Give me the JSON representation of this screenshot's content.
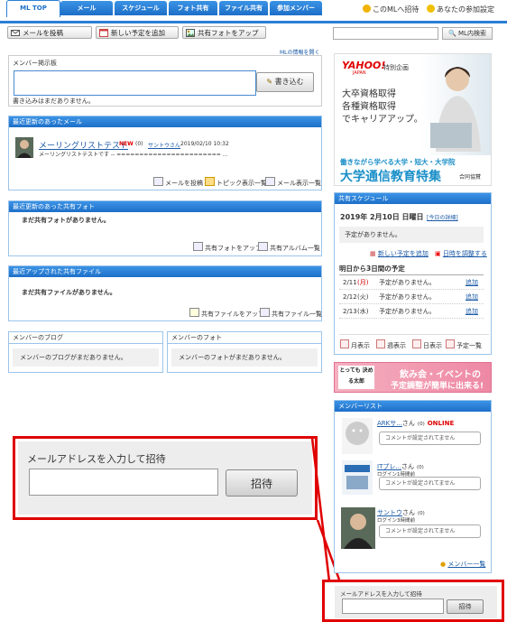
{
  "nav": {
    "tabs": [
      "ML TOP",
      "メール",
      "スケジュール",
      "フォト共有",
      "ファイル共有",
      "参加メンバー"
    ],
    "invite_link": "このMLへ招待",
    "settings_link": "あなたの参加設定"
  },
  "toolbar": {
    "post_mail": "メールを投稿",
    "add_schedule": "新しい予定を追加",
    "upload_photo": "共有フォトをアップ",
    "search_button": "ML内検索",
    "ml_info": "MLの情報を開く"
  },
  "board": {
    "title": "メンバー掲示板",
    "write_button": "書き込む",
    "empty": "書き込みはまだありません。"
  },
  "recent_mail": {
    "title": "最近更新のあったメール",
    "subject": "メーリングリストテスト",
    "new_badge": "NEW",
    "count": "(0)",
    "author": "サントウさん",
    "datetime": "2019/02/10 10:32",
    "preview": "メーリングリストテストです -- ======================= ...",
    "links": [
      "メールを投稿",
      "トピック表示一覧",
      "メール表示一覧"
    ]
  },
  "recent_photo": {
    "title": "最近更新のあった共有フォト",
    "empty": "まだ共有フォトがありません。",
    "links": [
      "共有フォトをアップ",
      "共有アルバム一覧"
    ]
  },
  "recent_file": {
    "title": "最近アップされた共有ファイル",
    "empty": "まだ共有ファイルがありません。",
    "links": [
      "共有ファイルをアップ",
      "共有ファイル一覧"
    ]
  },
  "member_blog": {
    "title": "メンバーのブログ",
    "empty": "メンバーのブログがまだありません。"
  },
  "member_photo": {
    "title": "メンバーのフォト",
    "empty": "メンバーのフォトがまだありません。"
  },
  "invite_zoom": {
    "label": "メールアドレスを入力して招待",
    "button": "招待"
  },
  "ad": {
    "logo": "YAHOO!",
    "logo_sub": "JAPAN",
    "tag": "特別企画",
    "lines": [
      "大卒資格取得",
      "各種資格取得",
      "でキャリアアップ。"
    ],
    "headline": "働きながら学べる大学・短大・大学院",
    "big": "大学通信教育特集",
    "sponsor": "合同協賛"
  },
  "schedule": {
    "title": "共有スケジュール",
    "date": "2019年 2月10日 日曜日",
    "today_link": "[今日の詳細]",
    "no_plan": "予定がありません。",
    "add_link": "新しい予定を追加",
    "adjust_link": "日時を調整する",
    "next_title": "明日から3日間の予定",
    "rows": [
      {
        "date": "2/11",
        "dow": "(月)",
        "text": "予定がありません。",
        "action": "追加",
        "dow_color": "#d00000"
      },
      {
        "date": "2/12",
        "dow": "(火)",
        "text": "予定がありません。",
        "action": "追加",
        "dow_color": "#333333"
      },
      {
        "date": "2/13",
        "dow": "(水)",
        "text": "予定がありません。",
        "action": "追加",
        "dow_color": "#333333"
      }
    ],
    "views": [
      "月表示",
      "週表示",
      "日表示",
      "予定一覧"
    ]
  },
  "banner": {
    "logo": "とっても 決める太郎",
    "line1": "飲み会・イベントの",
    "line2": "予定調整が簡単に出来る!"
  },
  "members": {
    "title": "メンバーリスト",
    "list": [
      {
        "name": "ARKサ...",
        "suffix": "さん",
        "count": "(0)",
        "status": "ONLINE",
        "login": "",
        "comment": "コメントが設定されてません"
      },
      {
        "name": "ITプレ...",
        "suffix": "さん",
        "count": "(0)",
        "status": "",
        "login": "ログイン1時間前",
        "comment": "コメントが設定されてません"
      },
      {
        "name": "サントウ",
        "suffix": "さん",
        "count": "(0)",
        "status": "",
        "login": "ログイン3時間前",
        "comment": "コメントが設定されてません"
      }
    ],
    "all_link": "メンバー一覧"
  },
  "invite_small": {
    "label": "メールアドレスを入力して招待",
    "button": "招待"
  },
  "colors": {
    "brand_blue": "#1d6fc8",
    "highlight_red": "#e00000",
    "new_red": "#e00000",
    "online_red": "#e00000"
  }
}
